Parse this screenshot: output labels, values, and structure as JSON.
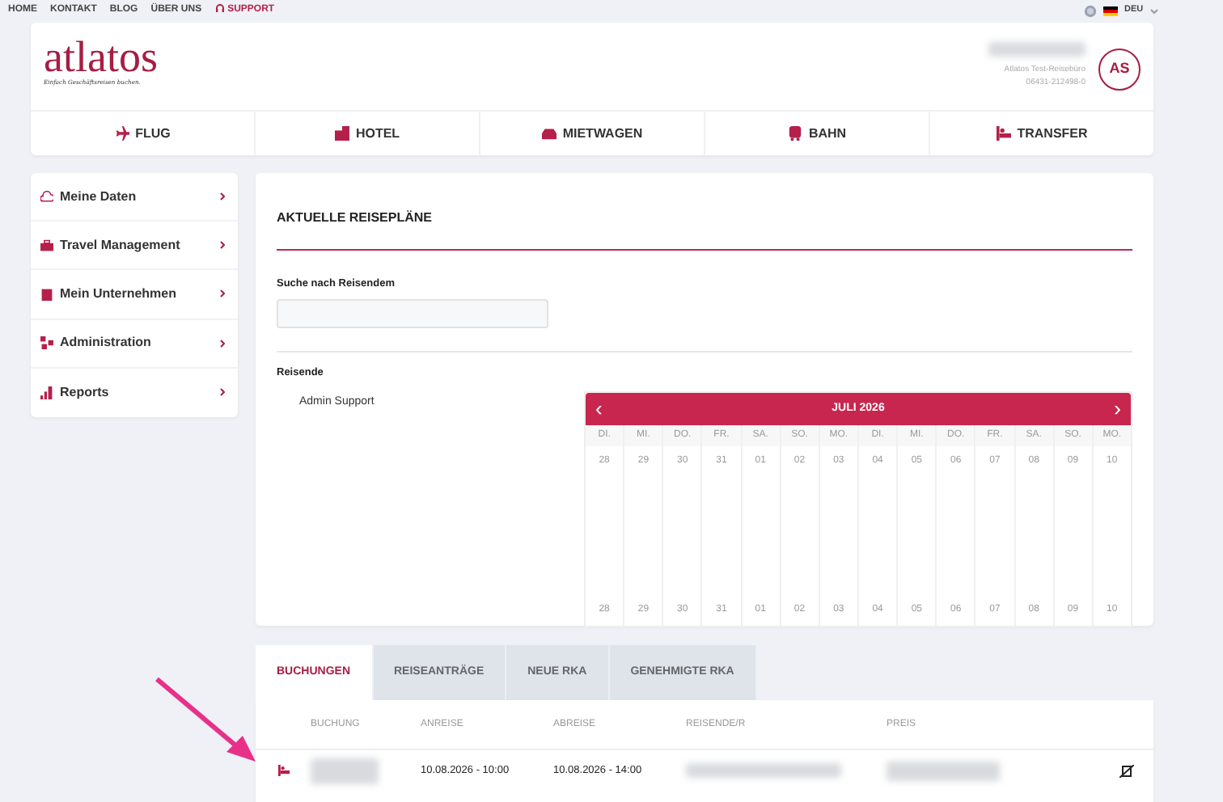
{
  "top_nav": [
    {
      "label": "HOME",
      "kind": "link"
    },
    {
      "label": "KONTAKT",
      "kind": "link"
    },
    {
      "label": "BLOG",
      "kind": "link"
    },
    {
      "label": "ÜBER UNS",
      "kind": "link"
    },
    {
      "label": "SUPPORT",
      "kind": "support"
    }
  ],
  "language": {
    "code": "DEU"
  },
  "logo": {
    "name": "atlatos",
    "tagline": "Einfach Geschäftsreisen buchen."
  },
  "account": {
    "company": "Atlatos Test-Reisebüro",
    "phone": "06431-212498-0",
    "initials": "AS"
  },
  "services": [
    {
      "label": "FLUG",
      "kind": "plane"
    },
    {
      "label": "HOTEL",
      "kind": "hotel"
    },
    {
      "label": "MIETWAGEN",
      "kind": "car"
    },
    {
      "label": "BAHN",
      "kind": "train"
    },
    {
      "label": "TRANSFER",
      "kind": "transfer"
    }
  ],
  "sidebar": {
    "items": [
      {
        "label": "Meine Daten",
        "kind": "cloud"
      },
      {
        "label": "Travel Management",
        "kind": "case"
      },
      {
        "label": "Mein Unternehmen",
        "kind": "building"
      },
      {
        "label": "Administration",
        "kind": "network"
      },
      {
        "label": "Reports",
        "kind": "chart"
      }
    ]
  },
  "plans": {
    "title": "AKTUELLE REISEPLÄNE",
    "search_label": "Suche nach Reisendem",
    "travelers_label": "Reisende",
    "travelers": [
      "Admin Support"
    ],
    "calendar": {
      "month": "JULI 2026",
      "prev": "‹",
      "next": "›",
      "days": [
        {
          "weekday": "DI.",
          "date": "28",
          "bottom_date": "28"
        },
        {
          "weekday": "MI.",
          "date": "29",
          "bottom_date": "29"
        },
        {
          "weekday": "DO.",
          "date": "30",
          "bottom_date": "30"
        },
        {
          "weekday": "FR.",
          "date": "31",
          "bottom_date": "31"
        },
        {
          "weekday": "SA.",
          "date": "01",
          "bottom_date": "01"
        },
        {
          "weekday": "SO.",
          "date": "02",
          "bottom_date": "02"
        },
        {
          "weekday": "MO.",
          "date": "03",
          "bottom_date": "03"
        },
        {
          "weekday": "DI.",
          "date": "04",
          "bottom_date": "04"
        },
        {
          "weekday": "MI.",
          "date": "05",
          "bottom_date": "05"
        },
        {
          "weekday": "DO.",
          "date": "06",
          "bottom_date": "06"
        },
        {
          "weekday": "FR.",
          "date": "07",
          "bottom_date": "07"
        },
        {
          "weekday": "SA.",
          "date": "08",
          "bottom_date": "08"
        },
        {
          "weekday": "SO.",
          "date": "09",
          "bottom_date": "09"
        },
        {
          "weekday": "MO.",
          "date": "10",
          "bottom_date": "10"
        }
      ]
    }
  },
  "tabs": [
    {
      "label": "BUCHUNGEN",
      "selected": true
    },
    {
      "label": "REISEANTRÄGE",
      "selected": false
    },
    {
      "label": "NEUE RKA",
      "selected": false
    },
    {
      "label": "GENEHMIGTE RKA",
      "selected": false
    }
  ],
  "table": {
    "columns": [
      "BUCHUNG",
      "ANREISE",
      "ABREISE",
      "REISENDE/R",
      "PREIS"
    ],
    "rows": [
      {
        "kind": "transfer",
        "arrival": "10.08.2026 - 10:00",
        "departure": "10.08.2026 - 14:00"
      }
    ]
  }
}
